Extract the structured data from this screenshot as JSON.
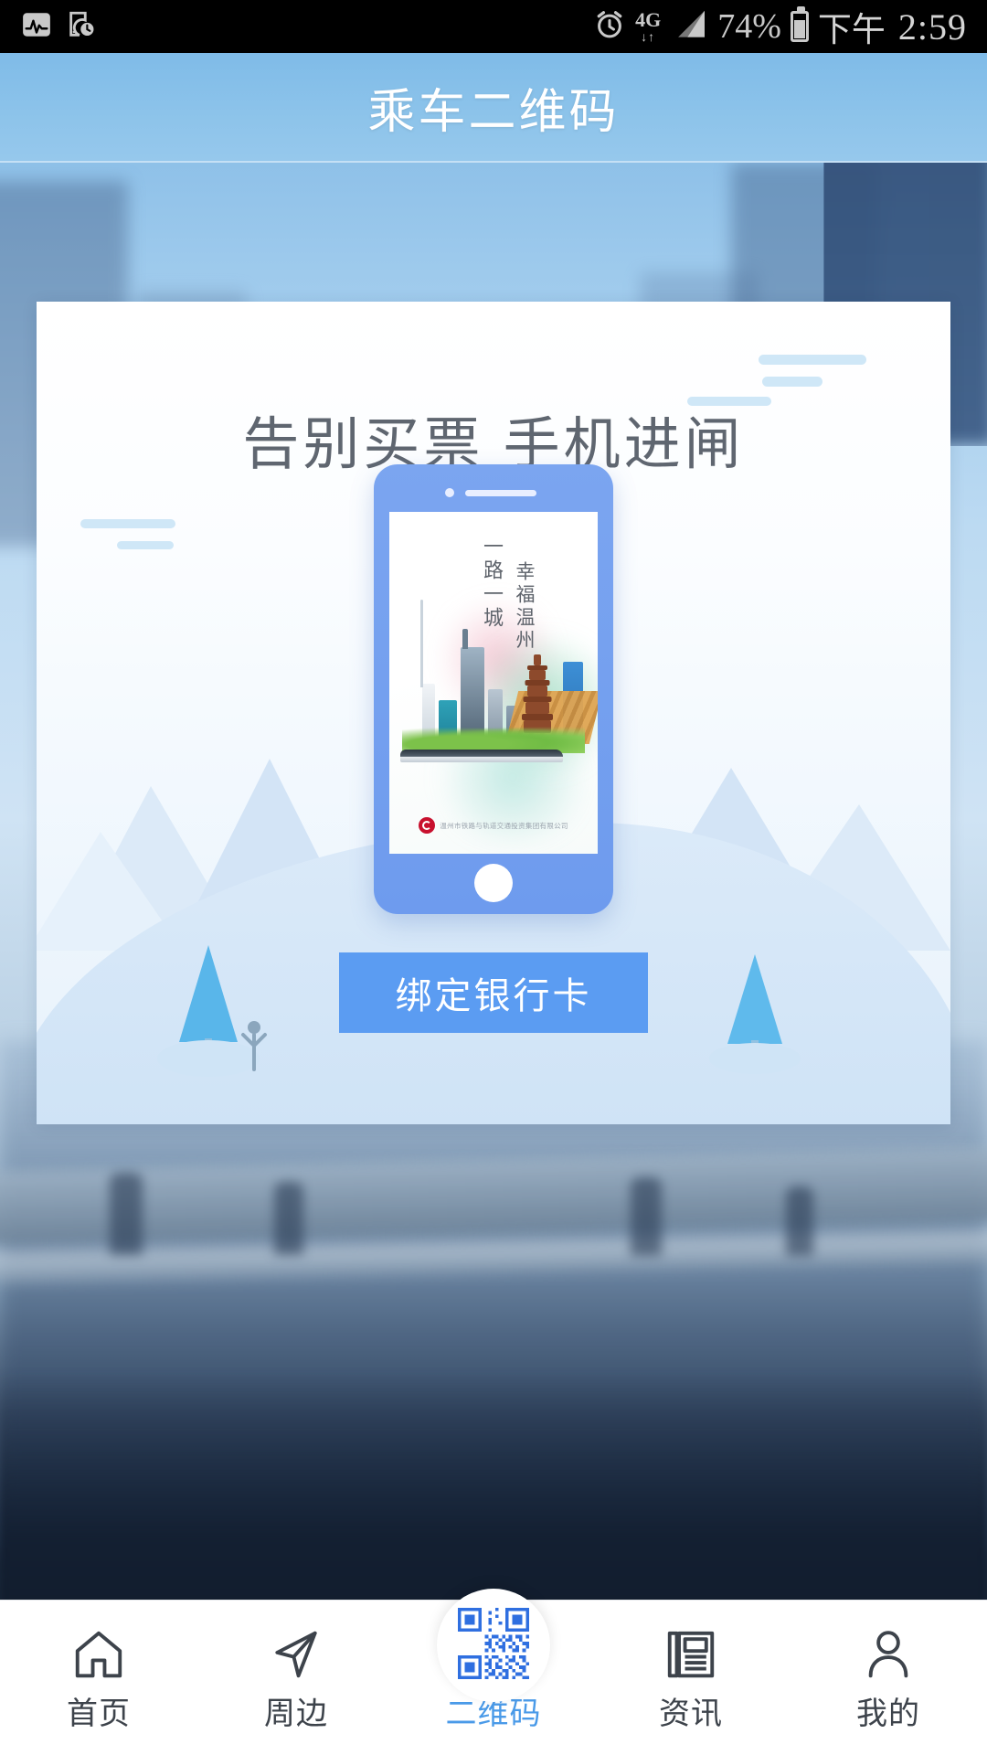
{
  "statusbar": {
    "left_icons": [
      "activity-monitor-icon",
      "phone-clock-icon"
    ],
    "alarm_icon": "alarm-clock-icon",
    "network_label": "4G",
    "network_arrows": "↓↑",
    "signal_icon": "signal-bars-icon",
    "battery_percent": "74%",
    "battery_icon": "battery-icon",
    "ampm": "下午",
    "time": "2:59"
  },
  "header": {
    "title": "乘车二维码",
    "bg_color": "#8cc3ea"
  },
  "card": {
    "headline": "告别买票  手机进闸",
    "poster": {
      "vertical_text_1": "一路一城",
      "vertical_text_2": "幸福温州",
      "company": "温州市铁路与轨道交通投资集团有限公司",
      "logo": "company-logo-icon"
    },
    "cta": {
      "label": "绑定银行卡",
      "color": "#5b9cf2"
    }
  },
  "tabbar": {
    "active_color": "#4a9ae8",
    "inactive_color": "#3d434b",
    "items": [
      {
        "label": "首页",
        "icon": "home-icon",
        "active": false
      },
      {
        "label": "周边",
        "icon": "paper-plane-icon",
        "active": false
      },
      {
        "label": "二维码",
        "icon": "qr-code-icon",
        "active": true
      },
      {
        "label": "资讯",
        "icon": "news-icon",
        "active": false
      },
      {
        "label": "我的",
        "icon": "person-icon",
        "active": false
      }
    ]
  }
}
